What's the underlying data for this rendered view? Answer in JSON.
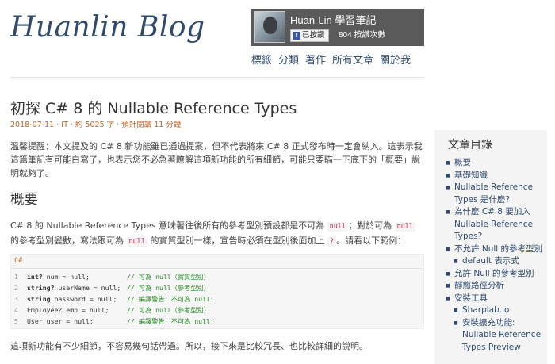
{
  "site": {
    "logo": "Huanlin Blog"
  },
  "fb": {
    "title": "Huan-Lin 學習筆記",
    "like_label": "已按讚",
    "like_icon": "facebook-icon",
    "count_text": "804 按讚次數"
  },
  "nav": [
    "標籤",
    "分類",
    "著作",
    "所有文章",
    "關於我"
  ],
  "post": {
    "title": "初探 C# 8 的 Nullable Reference Types",
    "meta": "2018-07-11 · IT · 約 5025 字 · 預計閱讀 11 分鐘",
    "intro": "溫馨提醒：本文提及的 C# 8 新功能雖已通過提案，但不代表將來 C# 8 正式發布時一定會納入。這表示我這篇筆記有可能白寫了，也表示您不必急著瞭解這項新功能的所有細節，可能只要瞄一下底下的「概要」說明就夠了。",
    "section_title": "概要",
    "para2_a": "C# 8 的 Nullable Reference Types 意味著往後所有的參考型別預設都是不可為 ",
    "para2_null1": "null",
    "para2_b": "；對於可為 ",
    "para2_null2": "null",
    "para2_c": " 的參考型別變數，寫法跟可為 ",
    "para2_null3": "null",
    "para2_d": " 的實質型別一樣，宣告時必須在型別後面加上 ",
    "para2_q": "?",
    "para2_e": "。請看以下範例：",
    "code_lang": "C#",
    "code_lines": [
      {
        "n": "1",
        "code": "int? num = null;",
        "kw": "int?",
        "rest": " num = null;",
        "comment": "// 可為 null（實質型別）"
      },
      {
        "n": "2",
        "code": "string? userName = null;",
        "kw": "string?",
        "rest": " userName = null;",
        "comment": "// 可為 null（參考型別）"
      },
      {
        "n": "3",
        "code": "string password = null;",
        "kw": "string",
        "rest": " password = null;",
        "comment": "// 編譯警告：不可為 null!"
      },
      {
        "n": "4",
        "code": "Employee? emp = null;",
        "kw": "",
        "rest": "Employee? emp = null;",
        "comment": "// 可為 null（參考型別）"
      },
      {
        "n": "5",
        "code": "User user = null;",
        "kw": "",
        "rest": "User user = null;",
        "comment": "// 編譯警告：不可為 null!"
      }
    ],
    "para3": "這項新功能有不少細節，不容易幾句話帶過。所以，接下來是比較冗長、也比較詳細的說明。"
  },
  "toc": {
    "title": "文章目錄",
    "items": [
      {
        "level": 1,
        "label": "概要"
      },
      {
        "level": 1,
        "label": "基礎知識"
      },
      {
        "level": 1,
        "label": "Nullable Reference Types 是什麼?"
      },
      {
        "level": 1,
        "label": "為什麼 C# 8 要加入 Nullable Reference Types?"
      },
      {
        "level": 1,
        "label": "不允許 Null 的參考型別"
      },
      {
        "level": 2,
        "label": "default 表示式"
      },
      {
        "level": 1,
        "label": "允許 Null 的參考型別"
      },
      {
        "level": 1,
        "label": "靜態路徑分析"
      },
      {
        "level": 1,
        "label": "安裝工具"
      },
      {
        "level": 2,
        "label": "Sharplab.io"
      },
      {
        "level": 2,
        "label": "安裝擴充功能: Nullable Reference Types Preview"
      }
    ]
  }
}
